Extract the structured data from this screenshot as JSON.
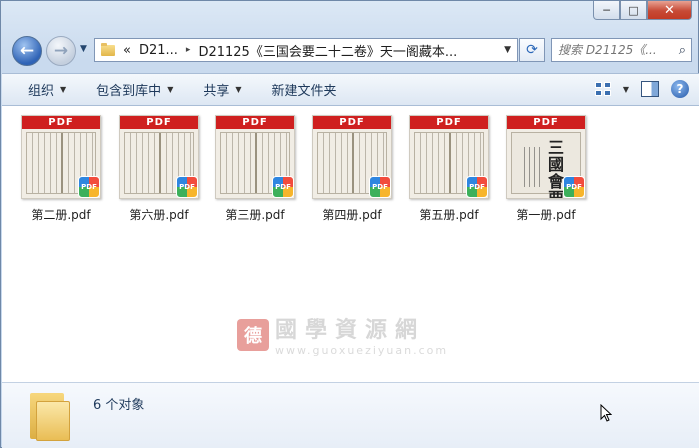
{
  "window": {
    "caption": {
      "minimize": "─",
      "maximize": "□",
      "close": "✕"
    }
  },
  "nav": {
    "back_glyph": "←",
    "forward_glyph": "→",
    "history_glyph": "▼",
    "address": {
      "prefix": "«",
      "crumb1": "D21...",
      "crumb2": "D21125《三国会要二十二卷》天一阁藏本...",
      "separator": "▸",
      "drop_glyph": "▼"
    },
    "refresh_glyph": "⟳",
    "search_placeholder": "搜索 D21125《...",
    "search_glyph": "⌕"
  },
  "toolbar": {
    "items": [
      {
        "label": "组织",
        "has_caret": true
      },
      {
        "label": "包含到库中",
        "has_caret": true
      },
      {
        "label": "共享",
        "has_caret": true
      },
      {
        "label": "新建文件夹",
        "has_caret": false
      }
    ],
    "caret": "▼",
    "help": "?"
  },
  "files": [
    {
      "name": "第二册.pdf",
      "banner": "PDF",
      "badge": "PDF",
      "thumb": "page"
    },
    {
      "name": "第六册.pdf",
      "banner": "PDF",
      "badge": "PDF",
      "thumb": "page"
    },
    {
      "name": "第三册.pdf",
      "banner": "PDF",
      "badge": "PDF",
      "thumb": "page"
    },
    {
      "name": "第四册.pdf",
      "banner": "PDF",
      "badge": "PDF",
      "thumb": "page"
    },
    {
      "name": "第五册.pdf",
      "banner": "PDF",
      "badge": "PDF",
      "thumb": "page"
    },
    {
      "name": "第一册.pdf",
      "banner": "PDF",
      "badge": "PDF",
      "thumb": "cover",
      "cover_title": "三國會要"
    }
  ],
  "watermark": {
    "seal": "德",
    "cn": "國學資源網",
    "url": "www.guoxueziyuan.com"
  },
  "details": {
    "count_text": "6 个对象"
  },
  "colors": {
    "pdf_red": "#cf1f1f",
    "toolbar_text": "#1e395b"
  }
}
